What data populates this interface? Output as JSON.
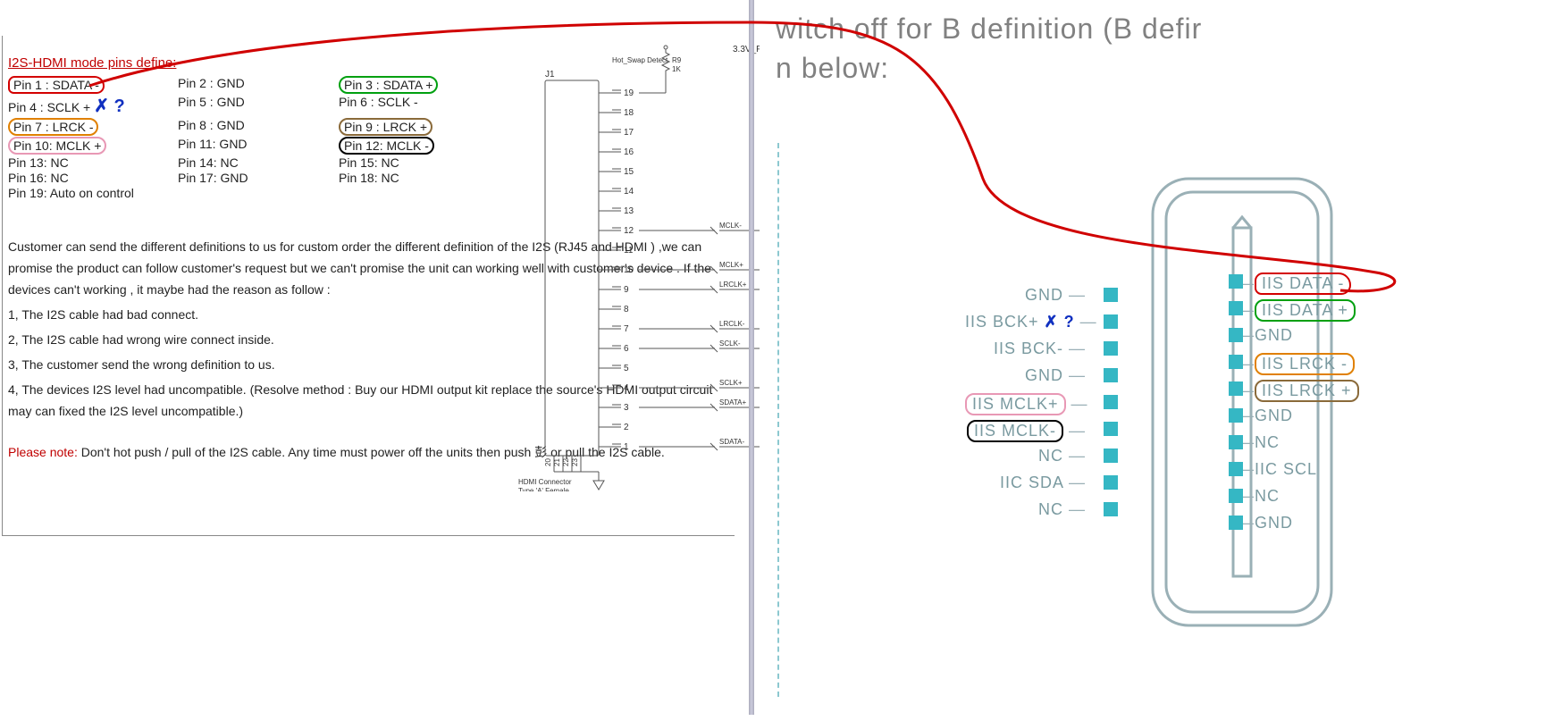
{
  "title": "I2S-HDMI mode pins define:",
  "pins": [
    [
      "Pin 1 : SDATA -",
      "Pin 2 : GND",
      "Pin 3 : SDATA +"
    ],
    [
      "Pin 4 : SCLK +",
      "Pin 5 : GND",
      "Pin 6 : SCLK -"
    ],
    [
      "Pin 7 : LRCK -",
      "Pin 8 : GND",
      "Pin 9 : LRCK +"
    ],
    [
      "Pin 10: MCLK +",
      "Pin 11: GND",
      "Pin 12: MCLK -"
    ],
    [
      "Pin 13: NC",
      "Pin 14: NC",
      "Pin 15: NC"
    ],
    [
      "Pin 16: NC",
      "Pin 17: GND",
      "Pin 18: NC"
    ]
  ],
  "pin19": "Pin 19: Auto on control",
  "qmark": "✗ ?",
  "para": " Customer can send the different definitions to us for custom order the different definition of the I2S (RJ45 and HDMI ) ,we can promise the product can follow customer's request  but we can't promise the unit can working well with customer's device . If the devices can't working , it maybe had the reason as follow :",
  "reasons": [
    "1, The I2S cable had bad connect.",
    "2, The I2S cable had wrong wire connect inside.",
    "3, The customer send the wrong definition to us.",
    "4, The devices I2S level had uncompatible. (Resolve method : Buy our HDMI output kit replace the source's HDMI output circuit may can fixed the I2S level uncompatible.)"
  ],
  "pnote_label": "Please note:",
  "pnote": " Don't hot push / pull of the I2S cable. Any time must power off the units then push 彭 or pull the I2S cable.",
  "schem": {
    "title1": "HDMI Connector",
    "title2": "Type 'A' Female",
    "j1": "J1",
    "vdd": "3.3V_F",
    "hotswap": "Hot_Swap Detect",
    "r9": "R9",
    "r9val": "1K",
    "bottom_pins": [
      "20",
      "21",
      "22",
      "23"
    ],
    "nets": {
      "12": "MCLK-",
      "10": "MCLK+",
      "9": "LRCLK+",
      "7": "LRCLK-",
      "6": "SCLK-",
      "4": "SCLK+",
      "3": "SDATA+",
      "1": "SDATA-"
    }
  },
  "right_header": "witch off for B definition (B defir\nn below:",
  "right_labels_left": [
    {
      "text": "GND"
    },
    {
      "text": "IIS BCK+",
      "mark": "✗ ?",
      "markcolor": "#1030c0"
    },
    {
      "text": "IIS BCK-"
    },
    {
      "text": "GND"
    },
    {
      "text": "IIS MCLK+",
      "pill": "pink"
    },
    {
      "text": "IIS MCLK-",
      "pill": "black"
    },
    {
      "text": "NC"
    },
    {
      "text": "IIC SDA"
    },
    {
      "text": "NC"
    }
  ],
  "right_labels_right": [
    {
      "text": "IIS DATA -",
      "pill": "red"
    },
    {
      "text": "IIS DATA +",
      "pill": "green"
    },
    {
      "text": "GND"
    },
    {
      "text": "IIS LRCK -",
      "pill": "orange"
    },
    {
      "text": "IIS LRCK +",
      "pill": "brown"
    },
    {
      "text": "GND"
    },
    {
      "text": "NC"
    },
    {
      "text": "IIC SCL"
    },
    {
      "text": "NC"
    },
    {
      "text": "GND"
    }
  ],
  "pill_map": {
    "0_0": "red",
    "0_2": "green",
    "2_0": "orange",
    "2_2": "brown",
    "3_0": "pink",
    "3_2": "black"
  }
}
